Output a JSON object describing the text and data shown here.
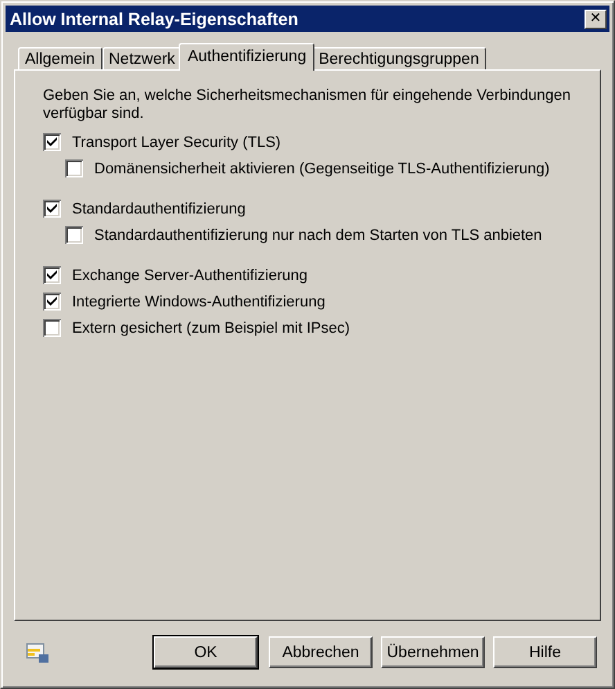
{
  "window": {
    "title": "Allow Internal Relay-Eigenschaften",
    "close": "✕"
  },
  "tabs": [
    {
      "label": "Allgemein",
      "selected": false
    },
    {
      "label": "Netzwerk",
      "selected": false
    },
    {
      "label": "Authentifizierung",
      "selected": true
    },
    {
      "label": "Berechtigungsgruppen",
      "selected": false
    }
  ],
  "intro": "Geben Sie an, welche Sicherheitsmechanismen für eingehende Verbindungen verfügbar sind.",
  "options": [
    {
      "label": "Transport Layer Security (TLS)",
      "checked": true,
      "children": [
        {
          "label": "Domänensicherheit aktivieren (Gegenseitige TLS-Authentifizierung)",
          "checked": false
        }
      ]
    },
    {
      "label": "Standardauthentifizierung",
      "checked": true,
      "children": [
        {
          "label": "Standardauthentifizierung nur nach dem Starten von TLS anbieten",
          "checked": false
        }
      ]
    },
    {
      "label": "Exchange Server-Authentifizierung",
      "checked": true
    },
    {
      "label": "Integrierte Windows-Authentifizierung",
      "checked": true
    },
    {
      "label": "Extern gesichert (zum Beispiel mit IPsec)",
      "checked": false
    }
  ],
  "buttons": [
    {
      "label": "OK",
      "default": true
    },
    {
      "label": "Abbrechen",
      "default": false
    },
    {
      "label": "Übernehmen",
      "default": false
    },
    {
      "label": "Hilfe",
      "default": false
    }
  ]
}
